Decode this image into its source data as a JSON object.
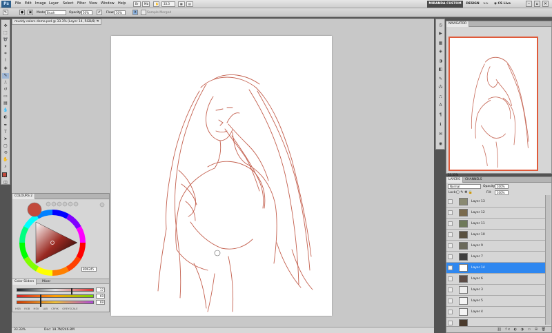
{
  "menubar": {
    "logo": "Ps",
    "items": [
      "File",
      "Edit",
      "Image",
      "Layer",
      "Select",
      "Filter",
      "View",
      "Window",
      "Help"
    ],
    "zoom": "33.3",
    "workspace_active": "MIRANDA CUSTOM",
    "workspace_other": "DESIGN",
    "more": ">>",
    "cs_live": "CS Live"
  },
  "options": {
    "mode_label": "Mode:",
    "mode_value": "Brush",
    "opacity_label": "Opacity:",
    "opacity_value": "50%",
    "flow_label": "Flow:",
    "flow_value": "50%",
    "sample_all": "Sample Merged"
  },
  "document": {
    "tab_title": "muddy colors demo.psd @ 33.3% (Layer 14, RGB/8) *"
  },
  "status": {
    "zoom": "33.33%",
    "doc": "Doc: 18.7M/246.8M"
  },
  "color_panel": {
    "tab": "COLOURS 2",
    "hex": "BD6245",
    "subtab_active": "Color Sliders",
    "subtab_other": "Mixer",
    "sliders": [
      {
        "value": "17",
        "color_stops": [
          "#1b2228",
          "#e2e2e2",
          "#dd3030"
        ]
      },
      {
        "value": "69",
        "color_stops": [
          "#d4222a",
          "#ff9e00",
          "#78d400"
        ]
      },
      {
        "value": "69",
        "color_stops": [
          "#d23a00",
          "#f0c23a",
          "#b04ad8"
        ]
      }
    ],
    "modes": [
      "HSB",
      "RGB",
      "HSV",
      "LAB",
      "CMYK",
      "GREYSCALE"
    ],
    "current_color": "#c24a3c"
  },
  "navigator": {
    "tab": "NAVIGATOR",
    "zoom": "33.33%"
  },
  "layers": {
    "tab_layers": "LAYERS",
    "tab_channels": "CHANNELS",
    "blend_mode": "Normal",
    "opacity_label": "Opacity:",
    "opacity_value": "100%",
    "lock_label": "Lock:",
    "fill_label": "Fill:",
    "fill_value": "100%",
    "rows": [
      {
        "name": "Layer 13",
        "selected": false,
        "thumb": "#8a8a72",
        "eye": false
      },
      {
        "name": "Layer 12",
        "selected": false,
        "thumb": "#7a6a4c",
        "eye": false
      },
      {
        "name": "Layer 11",
        "selected": false,
        "thumb": "#6f7a5a",
        "eye": false
      },
      {
        "name": "Layer 10",
        "selected": false,
        "thumb": "#5a5140",
        "eye": false
      },
      {
        "name": "Layer 9",
        "selected": false,
        "thumb": "#6b6a5b",
        "eye": false
      },
      {
        "name": "Layer 7",
        "selected": false,
        "thumb": "#3d3d3d",
        "eye": false
      },
      {
        "name": "Layer 14",
        "selected": true,
        "thumb": "#ffffff",
        "eye": true
      },
      {
        "name": "Layer 6",
        "selected": false,
        "thumb": "#5c4c46",
        "eye": false
      },
      {
        "name": "Layer 3",
        "selected": false,
        "thumb": "#eeeeee",
        "eye": false
      },
      {
        "name": "Layer 5",
        "selected": false,
        "thumb": "#f4f4f4",
        "eye": false
      },
      {
        "name": "Layer 4",
        "selected": false,
        "thumb": "#f4f4f4",
        "eye": false
      },
      {
        "name": "",
        "selected": false,
        "thumb": "#4a3a2c",
        "eye": false
      }
    ]
  },
  "colors": {
    "accent": "#2e87f0",
    "sketch": "#b9442f",
    "navigator_frame": "#e05a3a"
  }
}
